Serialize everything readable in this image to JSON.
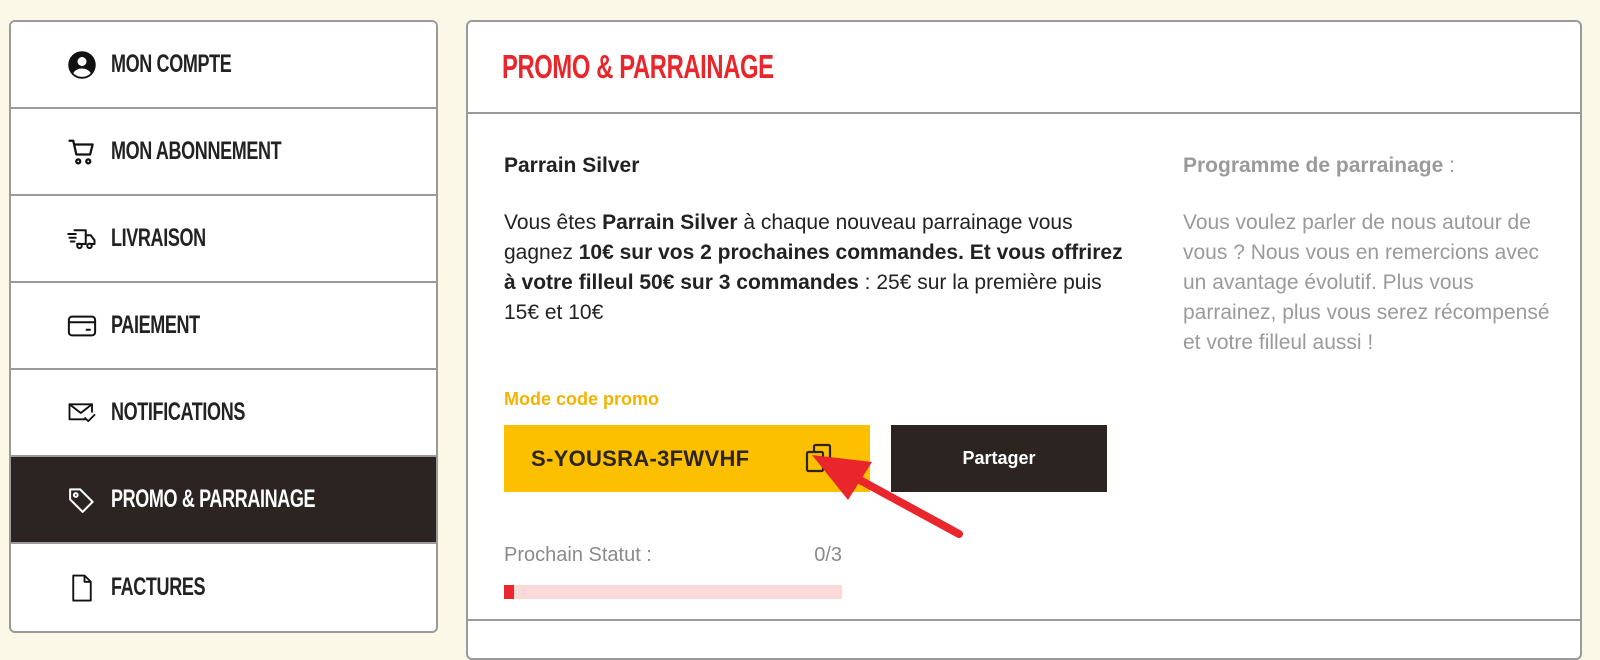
{
  "sidebar": {
    "items": [
      {
        "label": "Mon compte",
        "icon": "account-circle-icon"
      },
      {
        "label": "Mon abonnement",
        "icon": "shopping-cart-icon"
      },
      {
        "label": "Livraison",
        "icon": "delivery-truck-icon"
      },
      {
        "label": "Paiement",
        "icon": "credit-card-icon"
      },
      {
        "label": "Notifications",
        "icon": "mail-check-icon"
      },
      {
        "label": "Promo & Parrainage",
        "icon": "tag-icon",
        "active": true
      },
      {
        "label": "Factures",
        "icon": "file-icon"
      }
    ]
  },
  "main": {
    "title": "PROMO & PARRAINAGE",
    "tier": "Parrain Silver",
    "desc": {
      "p1": "Vous êtes ",
      "b1": "Parrain Silver",
      "p2": " à chaque nouveau parrainage vous gagnez ",
      "b2": "10€ sur vos 2 prochaines commandes. Et vous offrirez à votre filleul 50€ sur 3 commandes",
      "p3": " : 25€ sur la première puis 15€ et 10€"
    },
    "mode_label": "Mode code promo",
    "promo_code": "S-YOUSRA-3FWVHF",
    "share_label": "Partager",
    "next_status_label": "Prochain Statut :",
    "next_status_value": "0/3",
    "progress_fraction": 0.03,
    "program_title": "Programme de parrainage",
    "program_title_suffix": " :",
    "program_desc": "Vous voulez parler de nous autour de vous ? Nous vous en remercions avec un avantage évolutif. Plus vous parrainez, plus vous serez récompensé et votre filleul aussi !"
  },
  "colors": {
    "accent_red": "#e8262b",
    "accent_yellow": "#fcc000",
    "dark": "#2b2421",
    "background": "#fcf8e8"
  }
}
